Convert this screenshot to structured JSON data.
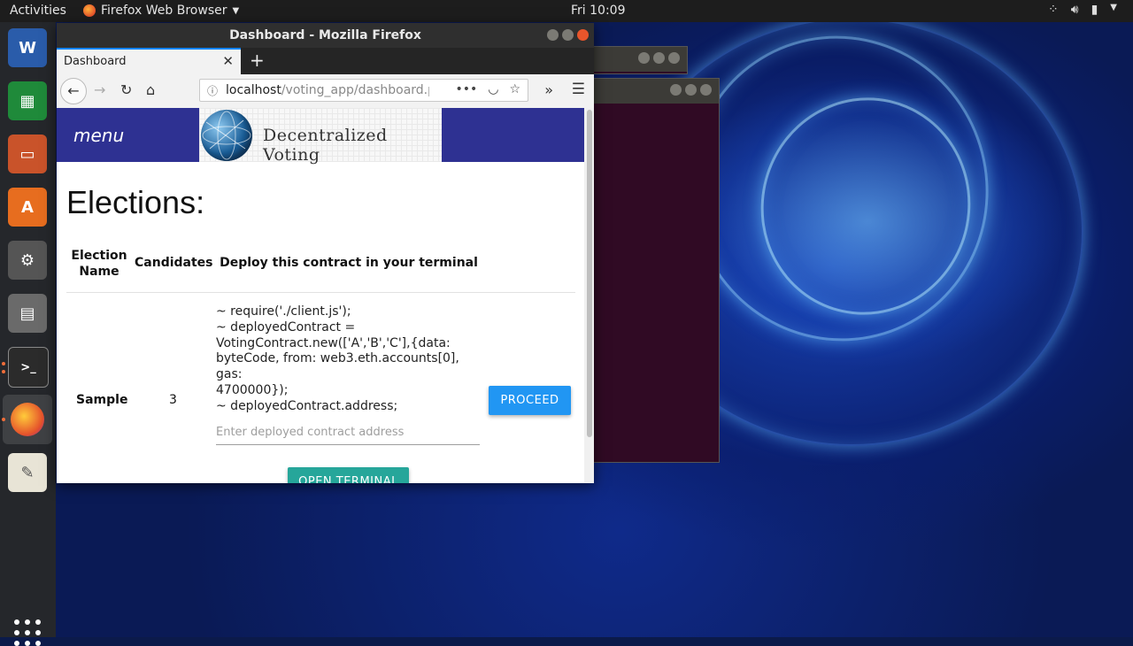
{
  "topbar": {
    "activities": "Activities",
    "app_name": "Firefox Web Browser",
    "clock": "Fri 10:09"
  },
  "firefox": {
    "window_title": "Dashboard - Mozilla Firefox",
    "tab_title": "Dashboard",
    "url_host": "localhost",
    "url_path": "/voting_app/dashboard.php"
  },
  "site": {
    "menu_label": "menu",
    "banner_text": "Decentralized Voting",
    "heading": "Elections:",
    "columns": [
      "Election Name",
      "Candidates",
      "Deploy this contract in your terminal"
    ],
    "row": {
      "election_name": "Sample",
      "candidates": "3",
      "code_lines": [
        "~ require('./client.js');",
        "~ deployedContract =",
        "VotingContract.new(['A','B','C'],{data:",
        "byteCode, from: web3.eth.accounts[0], gas:",
        "4700000});",
        "~ deployedContract.address;"
      ],
      "address_placeholder": "Enter deployed contract address",
      "proceed_label": "PROCEED",
      "open_terminal_label": "OPEN TERMINAL"
    }
  },
  "colors": {
    "nav_blue": "#2e3192",
    "proceed_blue": "#2196f3",
    "terminal_teal": "#26a69a"
  }
}
